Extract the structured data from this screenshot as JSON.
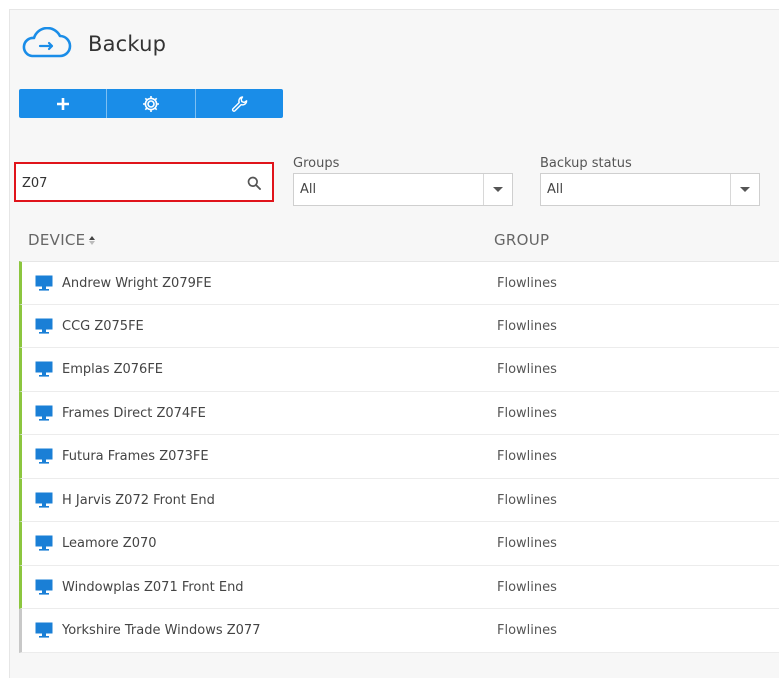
{
  "app": {
    "title": "Backup"
  },
  "toolbar": {
    "buttons": [
      {
        "icon": "plus-icon"
      },
      {
        "icon": "gear-icon"
      },
      {
        "icon": "wrench-icon"
      }
    ]
  },
  "search": {
    "value": "Z07",
    "highlight_color": "#e0141b"
  },
  "filters": {
    "groups": {
      "label": "Groups",
      "value": "All"
    },
    "backup_status": {
      "label": "Backup status",
      "value": "All"
    }
  },
  "columns": {
    "device": "DEVICE",
    "group": "GROUP"
  },
  "rows": [
    {
      "device": "Andrew Wright Z079FE",
      "group": "Flowlines",
      "status": "green"
    },
    {
      "device": "CCG Z075FE",
      "group": "Flowlines",
      "status": "green"
    },
    {
      "device": "Emplas Z076FE",
      "group": "Flowlines",
      "status": "green"
    },
    {
      "device": "Frames Direct Z074FE",
      "group": "Flowlines",
      "status": "green"
    },
    {
      "device": "Futura Frames Z073FE",
      "group": "Flowlines",
      "status": "green"
    },
    {
      "device": "H Jarvis Z072 Front End",
      "group": "Flowlines",
      "status": "green"
    },
    {
      "device": "Leamore Z070",
      "group": "Flowlines",
      "status": "green"
    },
    {
      "device": "Windowplas Z071 Front End",
      "group": "Flowlines",
      "status": "green"
    },
    {
      "device": "Yorkshire Trade Windows Z077",
      "group": "Flowlines",
      "status": "grey"
    }
  ],
  "colors": {
    "accent": "#1a8de8",
    "status_green": "#8cc63f",
    "status_grey": "#c8c8c8"
  }
}
